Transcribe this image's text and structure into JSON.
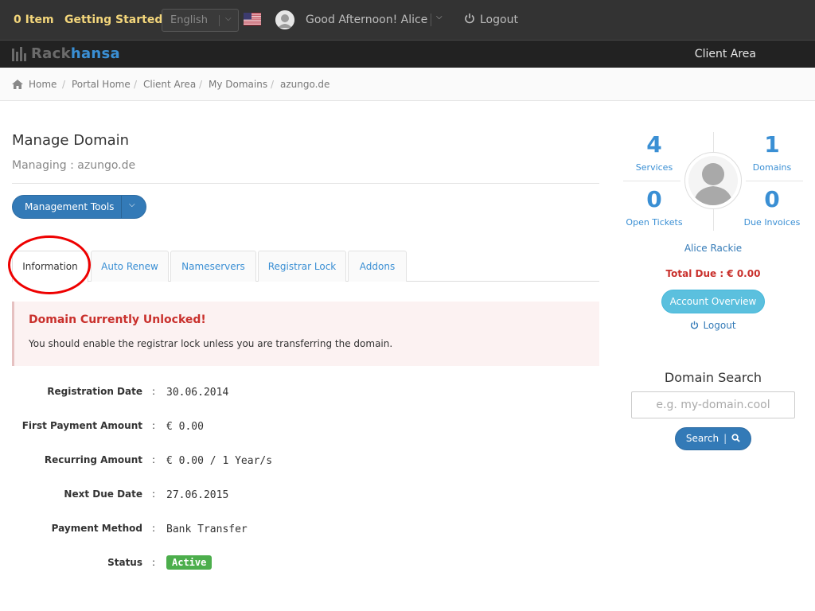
{
  "topbar": {
    "cart": "0 Item",
    "getting_started": "Getting Started",
    "language": "English",
    "greeting": "Good Afternoon! Alice",
    "logout": "Logout"
  },
  "brand": {
    "name_part1": "Rack",
    "name_part2": "hansa",
    "client_area": "Client Area"
  },
  "breadcrumb": [
    "Home",
    "Portal Home",
    "Client Area",
    "My Domains",
    "azungo.de"
  ],
  "page": {
    "title": "Manage Domain",
    "subtitle": "Managing : azungo.de",
    "management_tools": "Management Tools"
  },
  "tabs": [
    "Information",
    "Auto Renew",
    "Nameservers",
    "Registrar Lock",
    "Addons"
  ],
  "alert": {
    "heading": "Domain Currently Unlocked!",
    "text": "You should enable the registrar lock unless you are transferring the domain."
  },
  "info": [
    {
      "label": "Registration Date",
      "value": "30.06.2014"
    },
    {
      "label": "First Payment Amount",
      "value": "€ 0.00"
    },
    {
      "label": "Recurring Amount",
      "value": "€ 0.00 / 1 Year/s"
    },
    {
      "label": "Next Due Date",
      "value": "27.06.2015"
    },
    {
      "label": "Payment Method",
      "value": "Bank Transfer"
    },
    {
      "label": "Status",
      "value": "Active"
    }
  ],
  "sidebar": {
    "stats": [
      {
        "value": "4",
        "label": "Services"
      },
      {
        "value": "1",
        "label": "Domains"
      },
      {
        "value": "0",
        "label": "Open Tickets"
      },
      {
        "value": "0",
        "label": "Due Invoices"
      }
    ],
    "user_name": "Alice Rackie",
    "total_due": "Total Due : € 0.00",
    "account_overview": "Account Overview",
    "logout": "Logout",
    "domain_search": {
      "title": "Domain Search",
      "placeholder": "e.g. my-domain.cool",
      "button": "Search"
    }
  },
  "colors": {
    "accent": "#337ab7",
    "link": "#3a8fd4",
    "danger": "#c9302c",
    "success": "#4cae4c",
    "topbar_bg": "#333333",
    "highlight_label": "#f3d67b"
  }
}
